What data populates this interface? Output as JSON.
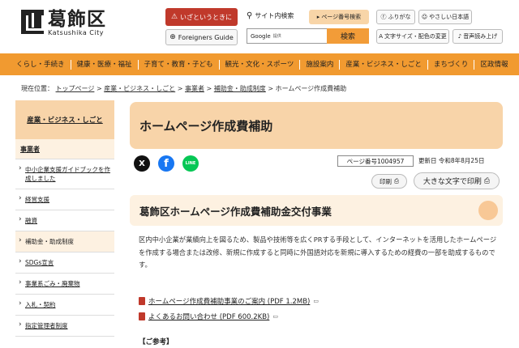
{
  "header": {
    "logo_name": "葛飾区",
    "logo_en": "Katsushika City",
    "emergency_label": "いざというときに",
    "foreign_label": "Foreigners Guide",
    "site_search_label": "サイト内検索",
    "pageno_search_label": "ページ番号検索",
    "search_placeholder": "Google",
    "search_note": "提供",
    "search_button": "検索",
    "furigana_label": "ふりがな",
    "easy_jp_label": "やさしい日本語",
    "fontsize_label": "文字サイズ・配色の変更",
    "voice_label": "音声読み上げ"
  },
  "nav": {
    "items": [
      "くらし・手続き",
      "健康・医療・福祉",
      "子育て・教育・子ども",
      "観光・文化・スポーツ",
      "施設案内",
      "産業・ビジネス・しごと",
      "まちづくり",
      "区政情報"
    ]
  },
  "breadcrumb": {
    "current_label": "現在位置：",
    "items": [
      "トップページ",
      "産業・ビジネス・しごと",
      "事業者",
      "補助金・助成制度"
    ],
    "current": "ホームページ作成費補助",
    "sep": ">"
  },
  "sidebar": {
    "heading": "産業・ビジネス・しごと",
    "sub": "事業者",
    "items": [
      "中小企業支援ガイドブックを作成しました",
      "経営支援",
      "融資",
      "補助金・助成制度",
      "SDGs宣言",
      "事業系ごみ・廃棄物",
      "入札・契約",
      "指定管理者制度"
    ]
  },
  "page": {
    "title": "ホームページ作成費補助",
    "page_number": "ページ番号1004957",
    "updated": "更新日 令和8年8月25日",
    "print_label": "印刷",
    "big_print_label": "大きな文字で印刷",
    "section_title": "葛飾区ホームページ作成費補助金交付事業",
    "body": "区内中小企業が業績向上を図るため、製品や技術等を広くPRする手段として、インターネットを活用したホームページを作成する場合または改修、新規に作成すると同時に外国語対応を新規に導入するための経費の一部を助成するものです。",
    "links": [
      "ホームページ作成費補助事業のご案内 (PDF 1.2MB)",
      "よくあるお問い合わせ (PDF 600.2KB)"
    ],
    "ref_heading": "【ご参考】"
  },
  "social": {
    "x": "X",
    "facebook": "f",
    "line": "LINE"
  },
  "colors": {
    "accent": "#f19a30",
    "title_bg": "#f8d4a9",
    "emergency": "#c0392b"
  }
}
